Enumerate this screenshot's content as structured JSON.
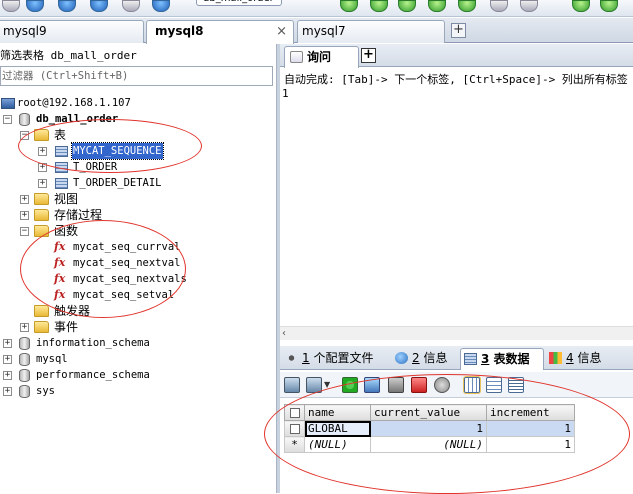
{
  "toolbar": {
    "connection_tab_partial": "db_mall_order"
  },
  "connection_tabs": [
    {
      "label": "mysql9",
      "active": false
    },
    {
      "label": "mysql8",
      "active": true
    },
    {
      "label": "mysql7",
      "active": false
    }
  ],
  "object_browser": {
    "filter_label": "筛选表格 db_mall_order",
    "filter_placeholder": "过滤器 (Ctrl+Shift+B)",
    "server": "root@192.168.1.107",
    "database": "db_mall_order",
    "tables_folder": "表",
    "tables": [
      "MYCAT_SEQUENCE",
      "T_ORDER",
      "T_ORDER_DETAIL"
    ],
    "views_folder": "视图",
    "procedures_folder": "存储过程",
    "functions_folder": "函数",
    "functions": [
      "mycat_seq_currval",
      "mycat_seq_nextval",
      "mycat_seq_nextvals",
      "mycat_seq_setval"
    ],
    "triggers_folder": "触发器",
    "events_folder": "事件",
    "other_databases": [
      "information_schema",
      "mysql",
      "performance_schema",
      "sys"
    ]
  },
  "query_editor": {
    "tab_label": "询问",
    "hint": "自动完成: [Tab]-> 下一个标签, [Ctrl+Space]-> 列出所有标签",
    "line_number": "1"
  },
  "result_tabs": [
    {
      "num": "1",
      "label": "个配置文件",
      "active": false
    },
    {
      "num": "2",
      "label": "信息",
      "active": false
    },
    {
      "num": "3",
      "label": "表数据",
      "active": true
    },
    {
      "num": "4",
      "label": "信息",
      "active": false
    }
  ],
  "result_grid": {
    "columns": [
      "name",
      "current_value",
      "increment"
    ],
    "rows": [
      {
        "name": "GLOBAL",
        "current_value": "1",
        "increment": "1"
      },
      {
        "marker": "*",
        "name": "(NULL)",
        "current_value": "(NULL)",
        "increment": "1"
      }
    ]
  },
  "colors": {
    "annotation": "#e0342c",
    "selection": "#3366cc"
  }
}
